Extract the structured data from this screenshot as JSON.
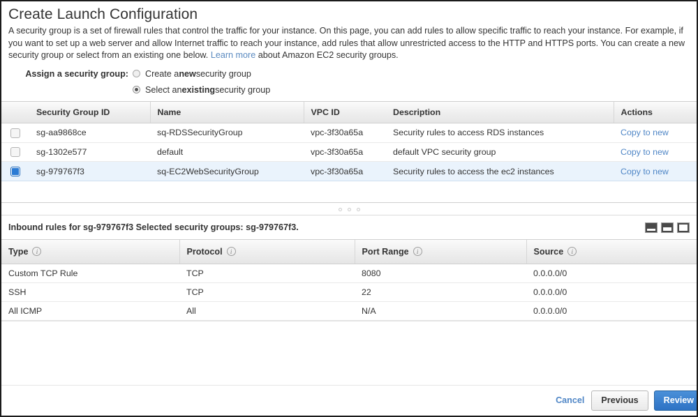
{
  "page": {
    "title": "Create Launch Configuration",
    "description_part1": "A security group is a set of firewall rules that control the traffic for your instance. On this page, you can add rules to allow specific traffic to reach your instance. For example, if you want to set up a web server and allow Internet traffic to reach your instance, add rules that allow unrestricted access to the HTTP and HTTPS ports. You can create a new security group or select from an existing one below. ",
    "learn_more": "Learn more",
    "description_part2": " about Amazon EC2 security groups."
  },
  "assign": {
    "label": "Assign a security group:",
    "option_new_prefix": "Create a ",
    "option_new_bold": "new",
    "option_new_suffix": " security group",
    "option_existing_prefix": "Select an ",
    "option_existing_bold": "existing",
    "option_existing_suffix": " security group",
    "selected": "existing"
  },
  "security_groups_table": {
    "columns": [
      "Security Group ID",
      "Name",
      "VPC ID",
      "Description",
      "Actions"
    ],
    "rows": [
      {
        "selected": false,
        "id": "sg-aa9868ce",
        "name": "sq-RDSSecurityGroup",
        "vpc": "vpc-3f30a65a",
        "description": "Security rules to access RDS instances",
        "action": "Copy to new"
      },
      {
        "selected": false,
        "id": "sg-1302e577",
        "name": "default",
        "vpc": "vpc-3f30a65a",
        "description": "default VPC security group",
        "action": "Copy to new"
      },
      {
        "selected": true,
        "id": "sg-979767f3",
        "name": "sq-EC2WebSecurityGroup",
        "vpc": "vpc-3f30a65a",
        "description": "Security rules to access the ec2 instances",
        "action": "Copy to new"
      }
    ]
  },
  "inbound": {
    "title": "Inbound rules for sg-979767f3 Selected security groups: sg-979767f3.",
    "columns": [
      "Type",
      "Protocol",
      "Port Range",
      "Source"
    ],
    "rows": [
      {
        "type": "Custom TCP Rule",
        "protocol": "TCP",
        "port_range": "8080",
        "source": "0.0.0.0/0"
      },
      {
        "type": "SSH",
        "protocol": "TCP",
        "port_range": "22",
        "source": "0.0.0.0/0"
      },
      {
        "type": "All ICMP",
        "protocol": "All",
        "port_range": "N/A",
        "source": "0.0.0.0/0"
      }
    ]
  },
  "footer": {
    "cancel": "Cancel",
    "previous": "Previous",
    "review": "Review"
  },
  "colors": {
    "link": "#4f86c6",
    "primary_button": "#2d72c4",
    "selected_row": "#eaf3fc",
    "checkbox_checked": "#2b7bd4"
  }
}
